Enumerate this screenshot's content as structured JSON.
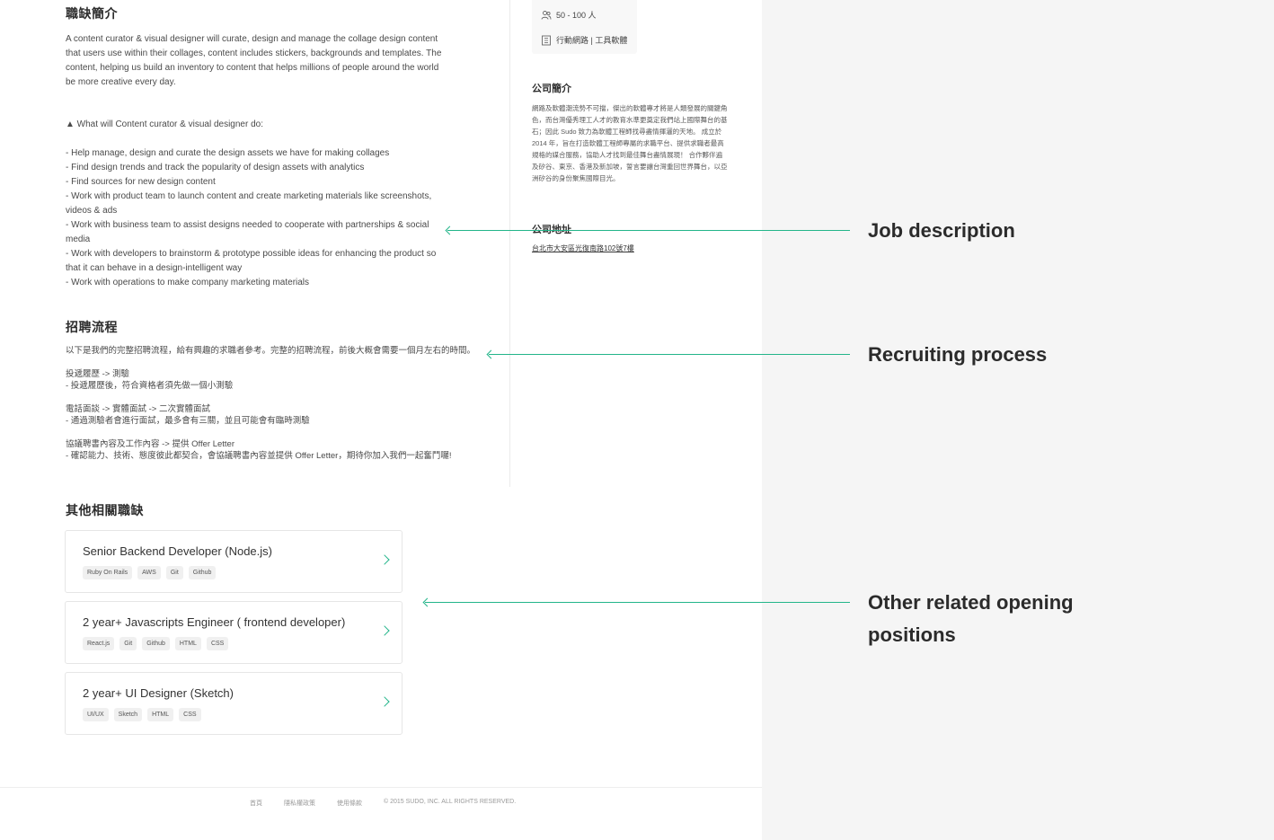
{
  "job_description": {
    "title": "職缺簡介",
    "intro": "A content curator & visual designer will curate, design and manage the collage design content that users use within their collages, content includes stickers, backgrounds and templates. The content, helping us build an inventory to content that helps millions of people around the world be more creative every day.",
    "heading": "▲ What will Content curator & visual designer do:",
    "items": [
      "- Help manage, design and curate the design assets we have for making collages",
      "- Find design trends and track the popularity of design assets with analytics",
      "- Find sources for new design content",
      "- Work with product team to launch content and create marketing materials like screenshots, videos & ads",
      "- Work with business team to assist designs needed to cooperate with partnerships & social media",
      "- Work with developers to brainstorm & prototype possible ideas for enhancing the product so that it can behave in a design-intelligent way",
      "- Work with operations to make company marketing materials"
    ]
  },
  "recruiting": {
    "title": "招聘流程",
    "intro": "以下是我們的完整招聘流程，給有興趣的求職者參考。完整的招聘流程，前後大概會需要一個月左右的時間。",
    "steps": [
      {
        "step": "投遞履歷 -> 測驗",
        "detail": "- 投遞履歷後，符合資格者須先做一個小測驗"
      },
      {
        "step": "電話面談 -> 實體面試 -> 二次實體面試",
        "detail": "- 通過測驗者會進行面試，最多會有三關，並且可能會有臨時測驗"
      },
      {
        "step": "協議聘書內容及工作內容 -> 提供 Offer Letter",
        "detail": "- 確認能力、技術、態度彼此都契合，會協議聘書內容並提供 Offer Letter，期待你加入我們一起奮鬥囉!"
      }
    ]
  },
  "other_jobs": {
    "title": "其他相關職缺",
    "jobs": [
      {
        "name": "Senior Backend Developer (Node.js)",
        "tags": [
          "Ruby On Rails",
          "AWS",
          "Git",
          "Github"
        ]
      },
      {
        "name": "2 year+ Javascripts Engineer ( frontend developer)",
        "tags": [
          "React.js",
          "Git",
          "Github",
          "HTML",
          "CSS"
        ]
      },
      {
        "name": "2 year+ UI Designer (Sketch)",
        "tags": [
          "UI/UX",
          "Sketch",
          "HTML",
          "CSS"
        ]
      }
    ]
  },
  "sidebar": {
    "company_size": "50 - 100 人",
    "industry": "行動網路 | 工具軟體",
    "company_intro_title": "公司簡介",
    "company_intro": "網路及軟體潮流勢不可擋，傑出的軟體專才將是人類發展的關鍵角色，而台灣優秀理工人才的教育水準更奠定我們站上國際舞台的基石；因此 Sudo 致力為軟體工程師找尋盡情揮灑的天地。 成立於 2014 年，旨在打造軟體工程師專屬的求職平台、提供求職者最高規格的媒合服務，協助人才找到最佳舞台盡情展現！ 合作夥伴遍及矽谷、東京、香港及新加坡，誓言要讓台灣重回世界舞台，以亞洲矽谷的身份聚焦國際目光。",
    "address_title": "公司地址",
    "address": "台北市大安區光復南路102號7樓"
  },
  "footer": {
    "home": "首頁",
    "privacy": "隱私權政策",
    "terms": "使用條款",
    "copyright": "© 2015 SUDO, INC. ALL RIGHTS RESERVED."
  },
  "annotations": {
    "job_description": "Job description",
    "recruiting_process": "Recruiting process",
    "other_related": "Other related opening positions"
  },
  "colors": {
    "accent": "#23b58a",
    "page_bg": "#ffffff",
    "canvas_bg": "#f5f5f5"
  }
}
